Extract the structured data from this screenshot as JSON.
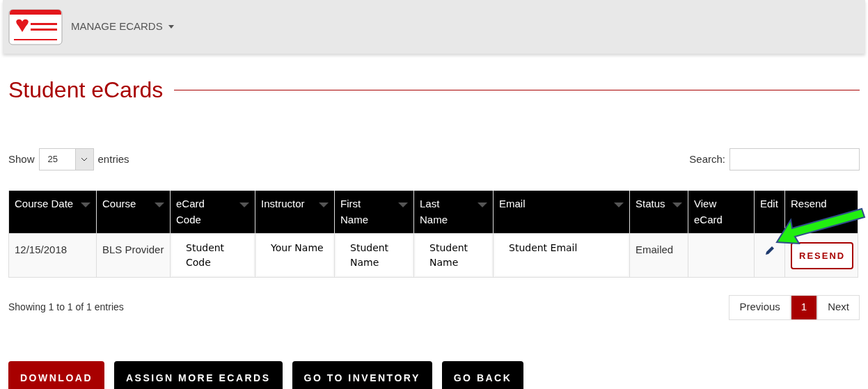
{
  "nav": {
    "menu": "MANAGE ECARDS"
  },
  "title": "Student eCards",
  "length": {
    "show": "Show",
    "value": "25",
    "entries": "entries"
  },
  "search": {
    "label": "Search:"
  },
  "table": {
    "columns": [
      {
        "label": "Course Date",
        "sortable": true
      },
      {
        "label": "Course",
        "sortable": true
      },
      {
        "label": "eCard Code",
        "sortable": true
      },
      {
        "label": "Instructor",
        "sortable": true
      },
      {
        "label": "First Name",
        "sortable": true
      },
      {
        "label": "Last Name",
        "sortable": true
      },
      {
        "label": "Email",
        "sortable": true
      },
      {
        "label": "Status",
        "sortable": true
      },
      {
        "label": "View eCard",
        "sortable": false
      },
      {
        "label": "Edit",
        "sortable": false
      },
      {
        "label": "Resend",
        "sortable": false
      }
    ],
    "rows": [
      [
        {
          "kind": "text",
          "text": "12/15/2018"
        },
        {
          "kind": "text",
          "text": "BLS Provider"
        },
        {
          "kind": "pasted",
          "text": "Student Code"
        },
        {
          "kind": "pasted",
          "text": "Your Name"
        },
        {
          "kind": "pasted",
          "text": "Student Name"
        },
        {
          "kind": "pasted",
          "text": "Student Name"
        },
        {
          "kind": "pasted",
          "text": "Student Email"
        },
        {
          "kind": "text",
          "text": "Emailed"
        },
        {
          "kind": "empty"
        },
        {
          "kind": "edit"
        },
        {
          "kind": "button",
          "text": "RESEND"
        }
      ]
    ]
  },
  "info": "Showing 1 to 1 of 1 entries",
  "pagination": [
    {
      "label": "Previous",
      "selected": false
    },
    {
      "label": "1",
      "selected": true
    },
    {
      "label": "Next",
      "selected": false
    }
  ],
  "actions": [
    {
      "label": "DOWNLOAD",
      "kind": "primary"
    },
    {
      "label": "ASSIGN MORE ECARDS",
      "kind": "dark"
    },
    {
      "label": "GO TO INVENTORY",
      "kind": "dark"
    },
    {
      "label": "GO BACK",
      "kind": "dark"
    }
  ]
}
